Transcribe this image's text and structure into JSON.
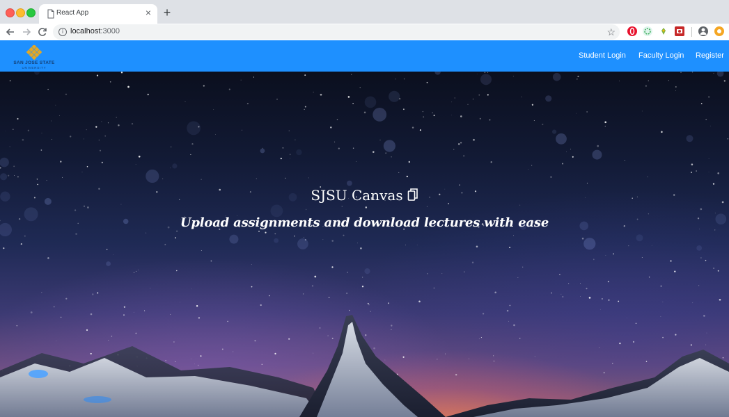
{
  "browser": {
    "tab_title": "React App",
    "url_host": "localhost",
    "url_port": ":3000"
  },
  "navbar": {
    "logo_line1": "SAN JOSE STATE",
    "logo_line2": "UNIVERSITY",
    "links": [
      {
        "label": "Student Login"
      },
      {
        "label": "Faculty Login"
      },
      {
        "label": "Register"
      }
    ]
  },
  "hero": {
    "title": "SJSU Canvas",
    "subtitle": "Upload assignments and download lectures with ease"
  },
  "colors": {
    "navbar_bg": "#1e90ff",
    "logo_gold": "#e5a823",
    "logo_blue": "#133f75"
  }
}
